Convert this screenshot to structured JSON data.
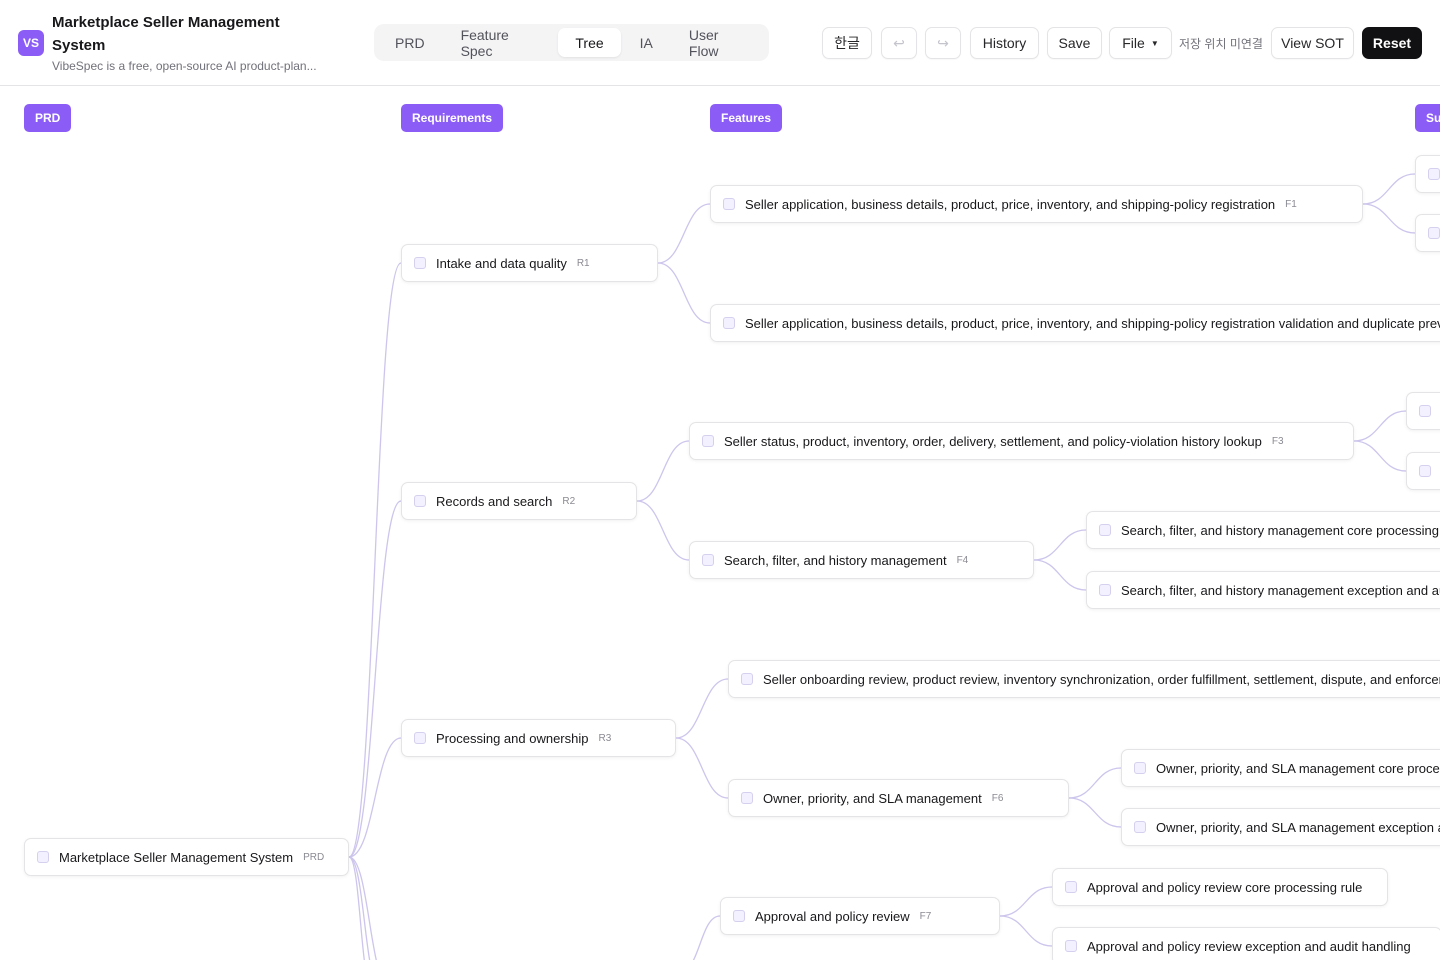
{
  "app": {
    "logo_text": "VS",
    "title": "Marketplace Seller Management System",
    "subtitle": "VibeSpec is a free, open-source AI product-plan..."
  },
  "tabs": [
    {
      "label": "PRD",
      "active": false
    },
    {
      "label": "Feature Spec",
      "active": false
    },
    {
      "label": "Tree",
      "active": true
    },
    {
      "label": "IA",
      "active": false
    },
    {
      "label": "User Flow",
      "active": false
    }
  ],
  "toolbar": {
    "lang_label": "한글",
    "undo_icon": "↩",
    "redo_icon": "↪",
    "history_label": "History",
    "save_label": "Save",
    "file_label": "File",
    "save_status": "저장 위치 미연결",
    "view_sot_label": "View SOT",
    "reset_label": "Reset"
  },
  "tree": {
    "columns": {
      "prd": "PRD",
      "requirements": "Requirements",
      "features": "Features",
      "sub": "Sub-features"
    },
    "root": {
      "label": "Marketplace Seller Management System",
      "id": "PRD"
    },
    "requirements": [
      {
        "label": "Intake and data quality",
        "id": "R1"
      },
      {
        "label": "Records and search",
        "id": "R2"
      },
      {
        "label": "Processing and ownership",
        "id": "R3"
      }
    ],
    "features": [
      {
        "label": "Seller application, business details, product, price, inventory, and shipping-policy registration",
        "id": "F1"
      },
      {
        "label": "Seller application, business details, product, price, inventory, and shipping-policy registration validation and duplicate prevention",
        "id": "F2"
      },
      {
        "label": "Seller status, product, inventory, order, delivery, settlement, and policy-violation history lookup",
        "id": "F3"
      },
      {
        "label": "Search, filter, and history management",
        "id": "F4"
      },
      {
        "label": "Seller onboarding review, product review, inventory synchronization, order fulfillment, settlement, dispute, and enforcement",
        "id": "F5"
      },
      {
        "label": "Owner, priority, and SLA management",
        "id": "F6"
      },
      {
        "label": "Approval and policy review",
        "id": "F7"
      }
    ],
    "subfeatures": [
      {
        "label": "",
        "id": ""
      },
      {
        "label": "",
        "id": ""
      },
      {
        "label": "",
        "id": ""
      },
      {
        "label": "",
        "id": ""
      },
      {
        "label": "Search, filter, and history management core processing rule",
        "id": ""
      },
      {
        "label": "Search, filter, and history management exception and audit handling",
        "id": ""
      },
      {
        "label": "Owner, priority, and SLA management core processing rule",
        "id": ""
      },
      {
        "label": "Owner, priority, and SLA management exception and audit handling",
        "id": ""
      },
      {
        "label": "Approval and policy review core processing rule",
        "id": ""
      },
      {
        "label": "Approval and policy review exception and audit handling",
        "id": ""
      }
    ]
  },
  "colors": {
    "accent": "#8b5cf6",
    "edge": "#cdc5ec",
    "dark_button": "#111113"
  }
}
